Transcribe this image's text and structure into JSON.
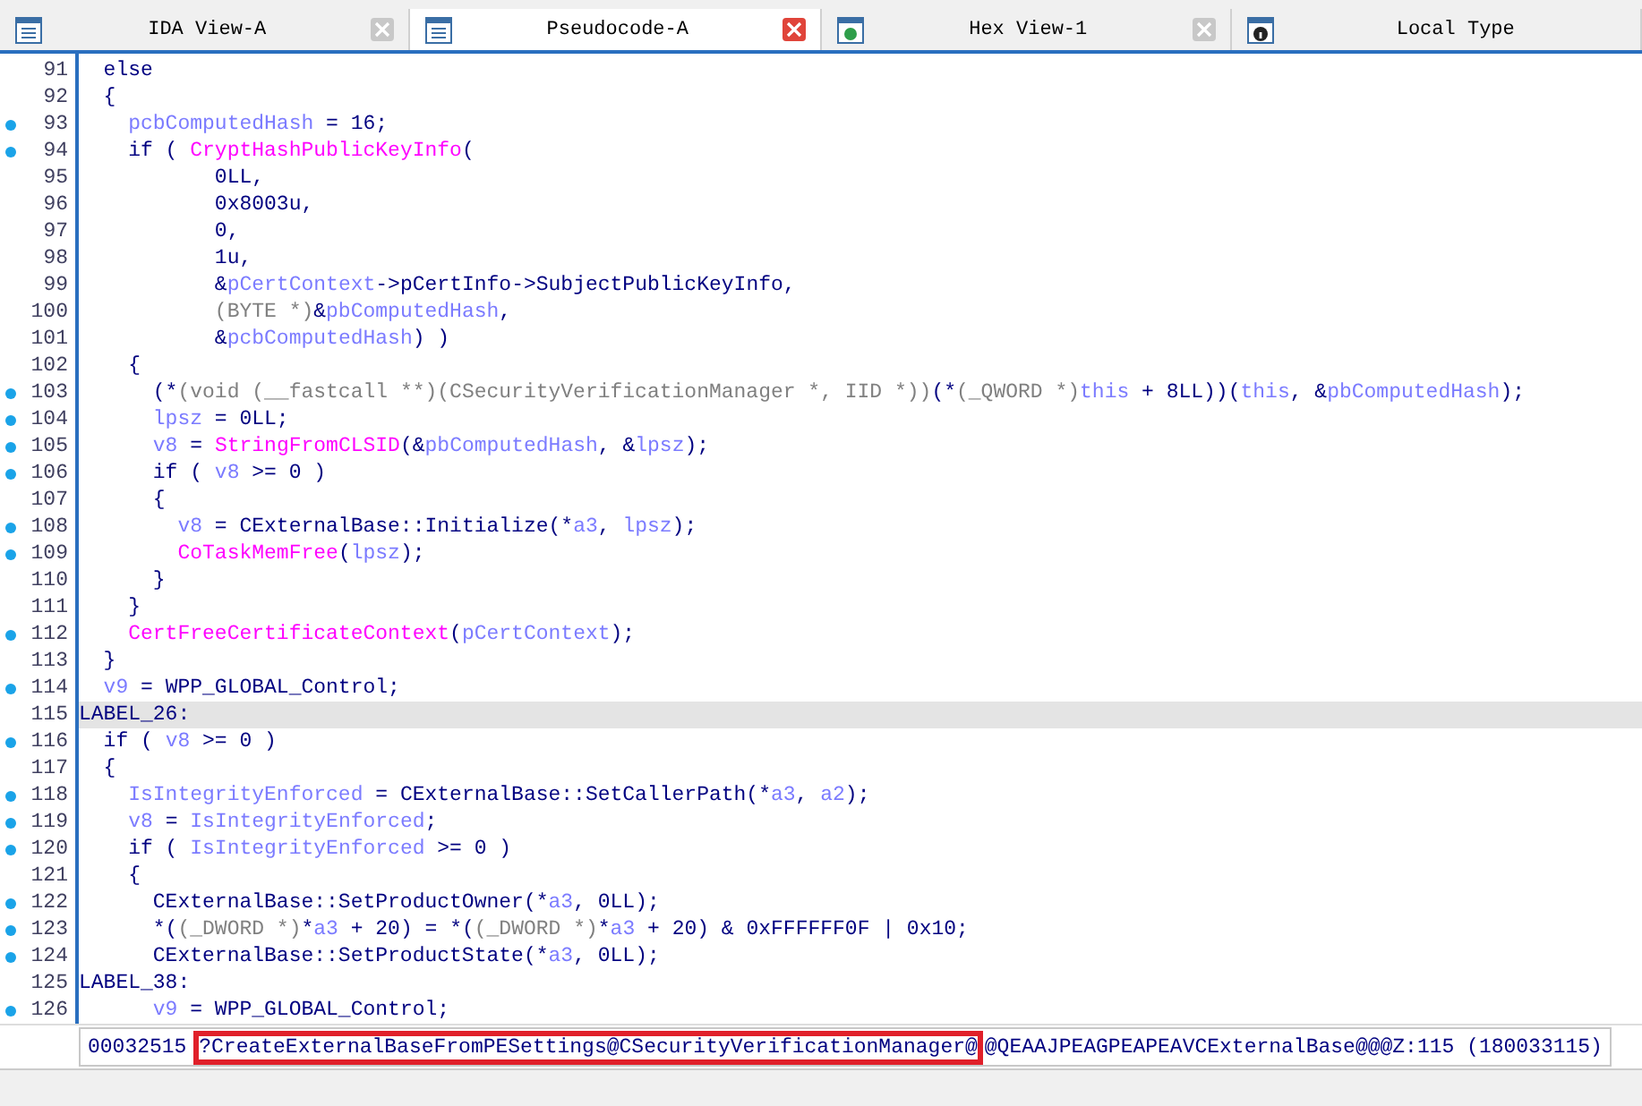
{
  "tabs": [
    {
      "label": "IDA View-A",
      "kind": "list",
      "selected": false
    },
    {
      "label": "Pseudocode-A",
      "kind": "list",
      "selected": true
    },
    {
      "label": "Hex View-1",
      "kind": "hex",
      "selected": false
    },
    {
      "label": "Local Type",
      "kind": "info",
      "selected": false
    }
  ],
  "code_lines": [
    {
      "number": "91",
      "dot": false,
      "highlighted": false,
      "tokens": [
        {
          "kind": "plain",
          "text": "  else"
        }
      ]
    },
    {
      "number": "92",
      "dot": false,
      "highlighted": false,
      "tokens": [
        {
          "kind": "plain",
          "text": "  {"
        }
      ]
    },
    {
      "number": "93",
      "dot": true,
      "highlighted": false,
      "tokens": [
        {
          "kind": "var",
          "text": "    pcbComputedHash"
        },
        {
          "kind": "plain",
          "text": " = 16;"
        }
      ]
    },
    {
      "number": "94",
      "dot": true,
      "highlighted": false,
      "tokens": [
        {
          "kind": "plain",
          "text": "    if ( "
        },
        {
          "kind": "func",
          "text": "CryptHashPublicKeyInfo"
        },
        {
          "kind": "plain",
          "text": "("
        }
      ]
    },
    {
      "number": "95",
      "dot": false,
      "highlighted": false,
      "tokens": [
        {
          "kind": "plain",
          "text": "           0LL,"
        }
      ]
    },
    {
      "number": "96",
      "dot": false,
      "highlighted": false,
      "tokens": [
        {
          "kind": "plain",
          "text": "           0x8003u,"
        }
      ]
    },
    {
      "number": "97",
      "dot": false,
      "highlighted": false,
      "tokens": [
        {
          "kind": "plain",
          "text": "           0,"
        }
      ]
    },
    {
      "number": "98",
      "dot": false,
      "highlighted": false,
      "tokens": [
        {
          "kind": "plain",
          "text": "           1u,"
        }
      ]
    },
    {
      "number": "99",
      "dot": false,
      "highlighted": false,
      "tokens": [
        {
          "kind": "plain",
          "text": "           &"
        },
        {
          "kind": "var",
          "text": "pCertContext"
        },
        {
          "kind": "plain",
          "text": "->pCertInfo->SubjectPublicKeyInfo,"
        }
      ]
    },
    {
      "number": "100",
      "dot": false,
      "highlighted": false,
      "tokens": [
        {
          "kind": "cast",
          "text": "           (BYTE *)"
        },
        {
          "kind": "plain",
          "text": "&"
        },
        {
          "kind": "var",
          "text": "pbComputedHash"
        },
        {
          "kind": "plain",
          "text": ","
        }
      ]
    },
    {
      "number": "101",
      "dot": false,
      "highlighted": false,
      "tokens": [
        {
          "kind": "plain",
          "text": "           &"
        },
        {
          "kind": "var",
          "text": "pcbComputedHash"
        },
        {
          "kind": "plain",
          "text": ") )"
        }
      ]
    },
    {
      "number": "102",
      "dot": false,
      "highlighted": false,
      "tokens": [
        {
          "kind": "plain",
          "text": "    {"
        }
      ]
    },
    {
      "number": "103",
      "dot": true,
      "highlighted": false,
      "tokens": [
        {
          "kind": "plain",
          "text": "      (*"
        },
        {
          "kind": "cast",
          "text": "(void (__fastcall **)(CSecurityVerificationManager *, IID *))"
        },
        {
          "kind": "plain",
          "text": "(*"
        },
        {
          "kind": "cast",
          "text": "(_QWORD *)"
        },
        {
          "kind": "var",
          "text": "this"
        },
        {
          "kind": "plain",
          "text": " + 8LL))("
        },
        {
          "kind": "var",
          "text": "this"
        },
        {
          "kind": "plain",
          "text": ", &"
        },
        {
          "kind": "var",
          "text": "pbComputedHash"
        },
        {
          "kind": "plain",
          "text": ");"
        }
      ]
    },
    {
      "number": "104",
      "dot": true,
      "highlighted": false,
      "tokens": [
        {
          "kind": "var",
          "text": "      lpsz"
        },
        {
          "kind": "plain",
          "text": " = 0LL;"
        }
      ]
    },
    {
      "number": "105",
      "dot": true,
      "highlighted": false,
      "tokens": [
        {
          "kind": "var",
          "text": "      v8"
        },
        {
          "kind": "plain",
          "text": " = "
        },
        {
          "kind": "func",
          "text": "StringFromCLSID"
        },
        {
          "kind": "plain",
          "text": "(&"
        },
        {
          "kind": "var",
          "text": "pbComputedHash"
        },
        {
          "kind": "plain",
          "text": ", &"
        },
        {
          "kind": "var",
          "text": "lpsz"
        },
        {
          "kind": "plain",
          "text": ");"
        }
      ]
    },
    {
      "number": "106",
      "dot": true,
      "highlighted": false,
      "tokens": [
        {
          "kind": "plain",
          "text": "      if ( "
        },
        {
          "kind": "var",
          "text": "v8"
        },
        {
          "kind": "plain",
          "text": " >= 0 )"
        }
      ]
    },
    {
      "number": "107",
      "dot": false,
      "highlighted": false,
      "tokens": [
        {
          "kind": "plain",
          "text": "      {"
        }
      ]
    },
    {
      "number": "108",
      "dot": true,
      "highlighted": false,
      "tokens": [
        {
          "kind": "var",
          "text": "        v8"
        },
        {
          "kind": "plain",
          "text": " = CExternalBase::Initialize(*"
        },
        {
          "kind": "var",
          "text": "a3"
        },
        {
          "kind": "plain",
          "text": ", "
        },
        {
          "kind": "var",
          "text": "lpsz"
        },
        {
          "kind": "plain",
          "text": ");"
        }
      ]
    },
    {
      "number": "109",
      "dot": true,
      "highlighted": false,
      "tokens": [
        {
          "kind": "func",
          "text": "        CoTaskMemFree"
        },
        {
          "kind": "plain",
          "text": "("
        },
        {
          "kind": "var",
          "text": "lpsz"
        },
        {
          "kind": "plain",
          "text": ");"
        }
      ]
    },
    {
      "number": "110",
      "dot": false,
      "highlighted": false,
      "tokens": [
        {
          "kind": "plain",
          "text": "      }"
        }
      ]
    },
    {
      "number": "111",
      "dot": false,
      "highlighted": false,
      "tokens": [
        {
          "kind": "plain",
          "text": "    }"
        }
      ]
    },
    {
      "number": "112",
      "dot": true,
      "highlighted": false,
      "tokens": [
        {
          "kind": "func",
          "text": "    CertFreeCertificateContext"
        },
        {
          "kind": "plain",
          "text": "("
        },
        {
          "kind": "var",
          "text": "pCertContext"
        },
        {
          "kind": "plain",
          "text": ");"
        }
      ]
    },
    {
      "number": "113",
      "dot": false,
      "highlighted": false,
      "tokens": [
        {
          "kind": "plain",
          "text": "  }"
        }
      ]
    },
    {
      "number": "114",
      "dot": true,
      "highlighted": false,
      "tokens": [
        {
          "kind": "var",
          "text": "  v9"
        },
        {
          "kind": "plain",
          "text": " = WPP_GLOBAL_Control;"
        }
      ]
    },
    {
      "number": "115",
      "dot": false,
      "highlighted": true,
      "tokens": [
        {
          "kind": "plain",
          "text": "LABEL_26:"
        }
      ]
    },
    {
      "number": "116",
      "dot": true,
      "highlighted": false,
      "tokens": [
        {
          "kind": "plain",
          "text": "  if ( "
        },
        {
          "kind": "var",
          "text": "v8"
        },
        {
          "kind": "plain",
          "text": " >= 0 )"
        }
      ]
    },
    {
      "number": "117",
      "dot": false,
      "highlighted": false,
      "tokens": [
        {
          "kind": "plain",
          "text": "  {"
        }
      ]
    },
    {
      "number": "118",
      "dot": true,
      "highlighted": false,
      "tokens": [
        {
          "kind": "var",
          "text": "    IsIntegrityEnforced"
        },
        {
          "kind": "plain",
          "text": " = CExternalBase::SetCallerPath(*"
        },
        {
          "kind": "var",
          "text": "a3"
        },
        {
          "kind": "plain",
          "text": ", "
        },
        {
          "kind": "var",
          "text": "a2"
        },
        {
          "kind": "plain",
          "text": ");"
        }
      ]
    },
    {
      "number": "119",
      "dot": true,
      "highlighted": false,
      "tokens": [
        {
          "kind": "var",
          "text": "    v8"
        },
        {
          "kind": "plain",
          "text": " = "
        },
        {
          "kind": "var",
          "text": "IsIntegrityEnforced"
        },
        {
          "kind": "plain",
          "text": ";"
        }
      ]
    },
    {
      "number": "120",
      "dot": true,
      "highlighted": false,
      "tokens": [
        {
          "kind": "plain",
          "text": "    if ( "
        },
        {
          "kind": "var",
          "text": "IsIntegrityEnforced"
        },
        {
          "kind": "plain",
          "text": " >= 0 )"
        }
      ]
    },
    {
      "number": "121",
      "dot": false,
      "highlighted": false,
      "tokens": [
        {
          "kind": "plain",
          "text": "    {"
        }
      ]
    },
    {
      "number": "122",
      "dot": true,
      "highlighted": false,
      "tokens": [
        {
          "kind": "plain",
          "text": "      CExternalBase::SetProductOwner(*"
        },
        {
          "kind": "var",
          "text": "a3"
        },
        {
          "kind": "plain",
          "text": ", 0LL);"
        }
      ]
    },
    {
      "number": "123",
      "dot": true,
      "highlighted": false,
      "tokens": [
        {
          "kind": "plain",
          "text": "      *("
        },
        {
          "kind": "cast",
          "text": "(_DWORD *)"
        },
        {
          "kind": "plain",
          "text": "*"
        },
        {
          "kind": "var",
          "text": "a3"
        },
        {
          "kind": "plain",
          "text": " + 20) = *("
        },
        {
          "kind": "cast",
          "text": "(_DWORD *)"
        },
        {
          "kind": "plain",
          "text": "*"
        },
        {
          "kind": "var",
          "text": "a3"
        },
        {
          "kind": "plain",
          "text": " + 20) & 0xFFFFFF0F | 0x10;"
        }
      ]
    },
    {
      "number": "124",
      "dot": true,
      "highlighted": false,
      "tokens": [
        {
          "kind": "plain",
          "text": "      CExternalBase::SetProductState(*"
        },
        {
          "kind": "var",
          "text": "a3"
        },
        {
          "kind": "plain",
          "text": ", 0LL);"
        }
      ]
    },
    {
      "number": "125",
      "dot": false,
      "highlighted": false,
      "tokens": [
        {
          "kind": "plain",
          "text": "LABEL_38:"
        }
      ]
    },
    {
      "number": "126",
      "dot": true,
      "highlighted": false,
      "tokens": [
        {
          "kind": "var",
          "text": "      v9"
        },
        {
          "kind": "plain",
          "text": " = WPP_GLOBAL_Control;"
        }
      ]
    }
  ],
  "location_bar": {
    "address": "00032515",
    "marked_text": "?CreateExternalBaseFromPESettings@CSecurityVerificationManager@",
    "rest": "@QEAAJPEAGPEAPEAVCExternalBase@@@Z:115 (180033115)"
  }
}
